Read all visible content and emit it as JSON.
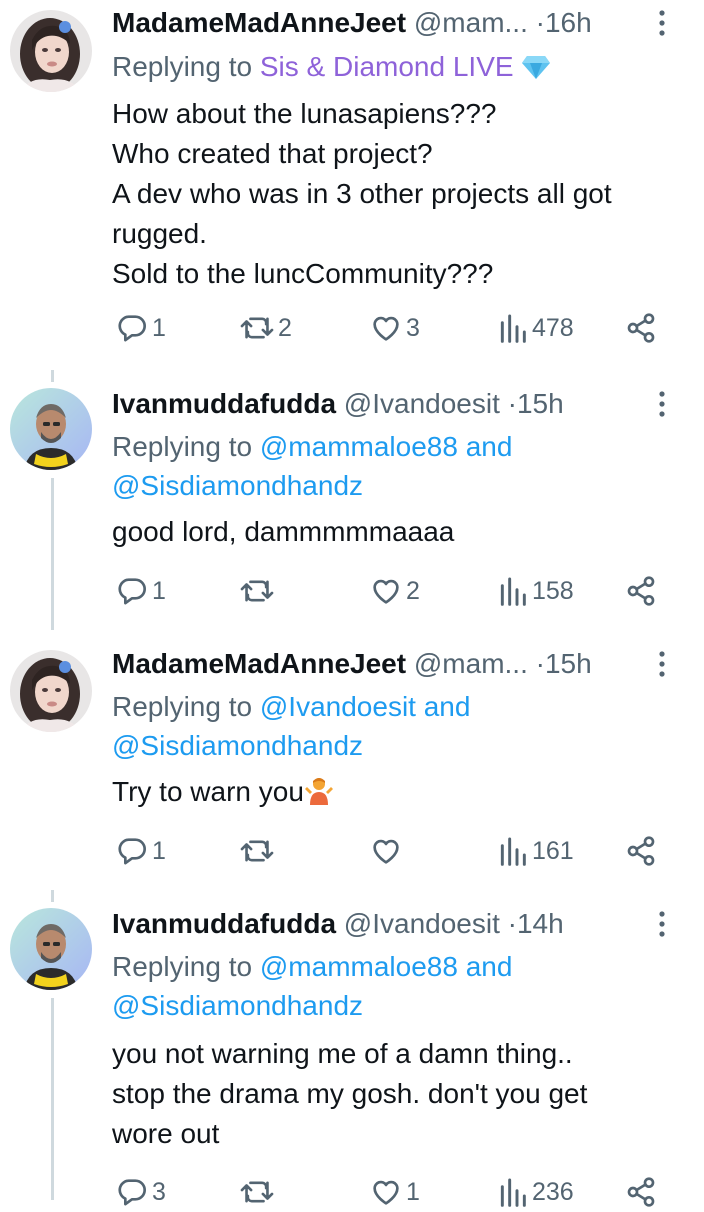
{
  "tweets": [
    {
      "name": "MadameMadAnneJeet",
      "handle": "@mam...",
      "dot": "·",
      "time": "16h",
      "replying_prefix": "Replying to",
      "replying_to_1": "Sis & Diamond LIVE",
      "replying_to_1_emoji": "gem-emoji",
      "body_lines": [
        "How about the lunasapiens???",
        "Who created that project?",
        "A dev who was in 3 other projects all got",
        "rugged.",
        "Sold to the luncCommunity???"
      ],
      "replies": "1",
      "retweets": "2",
      "likes": "3",
      "views": "478"
    },
    {
      "name": "Ivanmuddafudda",
      "handle": "@Ivandoesit",
      "dot": "·",
      "time": "15h",
      "replying_prefix": "Replying to",
      "replying_to_1": "@mammaloe88",
      "replying_and": "and",
      "replying_to_2": "@Sisdiamondhandz",
      "body_lines": [
        "good lord, dammmmmaaaa"
      ],
      "replies": "1",
      "retweets": "",
      "likes": "2",
      "views": "158"
    },
    {
      "name": "MadameMadAnneJeet",
      "handle": "@mam...",
      "dot": "·",
      "time": "15h",
      "replying_prefix": "Replying to",
      "replying_to_1": "@Ivandoesit",
      "replying_and": "and",
      "replying_to_2": "@Sisdiamondhandz",
      "body_lines": [
        "Try to warn you"
      ],
      "body_emoji": "person-shrugging-emoji",
      "replies": "1",
      "retweets": "",
      "likes": "",
      "views": "161"
    },
    {
      "name": "Ivanmuddafudda",
      "handle": "@Ivandoesit",
      "dot": "·",
      "time": "14h",
      "replying_prefix": "Replying to",
      "replying_to_1": "@mammaloe88",
      "replying_and": "and",
      "replying_to_2": "@Sisdiamondhandz",
      "body_lines": [
        "you not warning me of a damn thing..",
        "stop the drama my gosh. don't you get",
        "wore out"
      ],
      "replies": "3",
      "retweets": "",
      "likes": "1",
      "views": "236"
    }
  ],
  "colors": {
    "text": "#0f1419",
    "secondary": "#536471",
    "link": "#1d9bf0",
    "display_name_link": "#8e62d9",
    "thread_line": "#cfd9de"
  }
}
